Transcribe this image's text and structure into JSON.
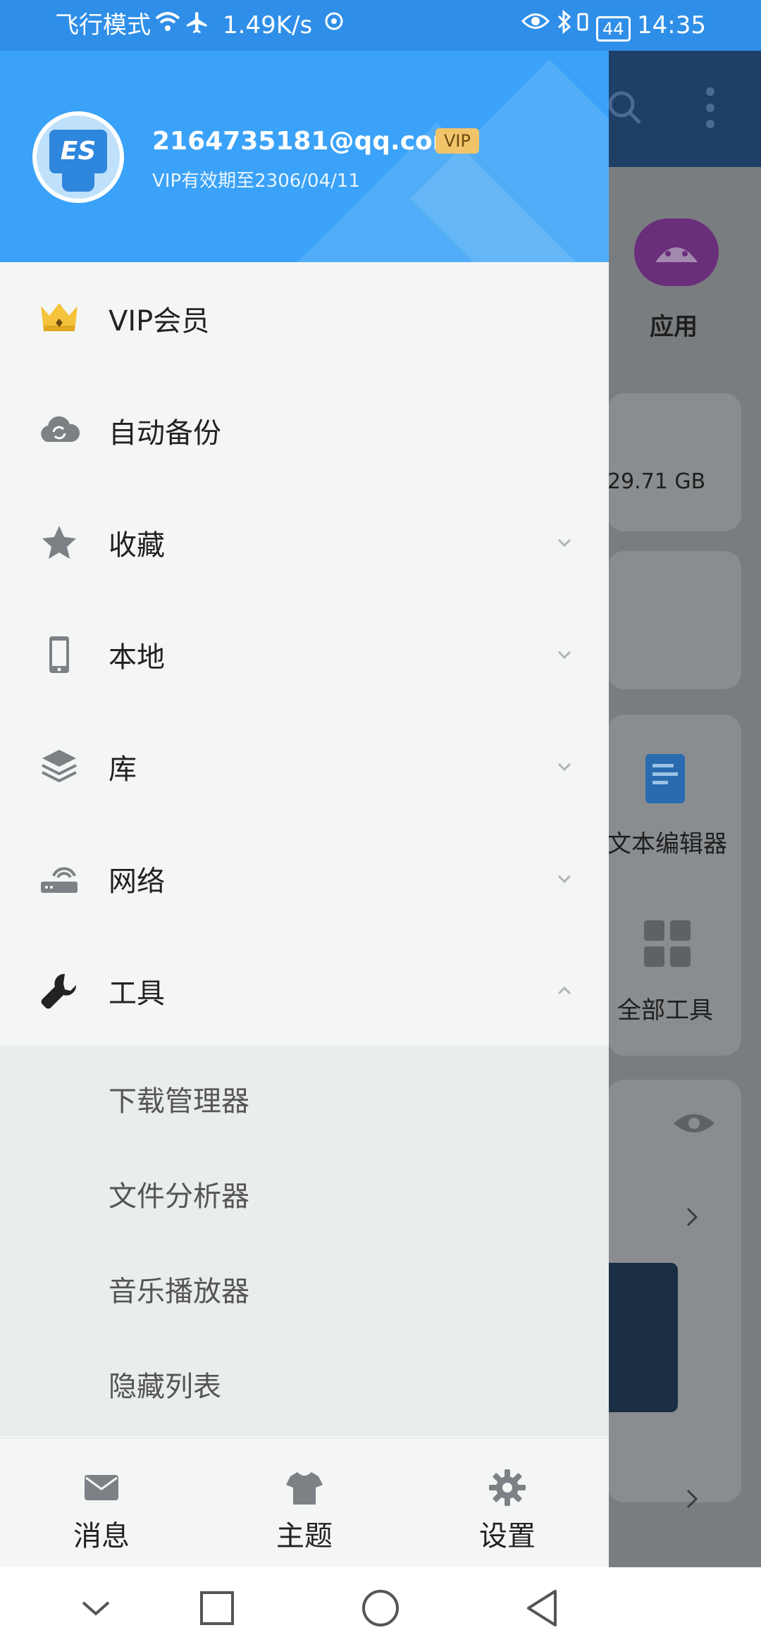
{
  "status_bar": {
    "left_text": "飞行模式",
    "speed": "1.49K/s",
    "battery": "44",
    "time": "14:35"
  },
  "background_app": {
    "app_label": "应用",
    "storage_text": "29.71 GB",
    "tool_text_editor": "文本编辑器",
    "tool_all_tools": "全部工具"
  },
  "drawer": {
    "header": {
      "email": "2164735181@qq.com",
      "vip_badge": "VIP",
      "vip_expire": "VIP有效期至2306/04/11"
    },
    "menu": [
      {
        "label": "VIP会员",
        "icon": "crown-icon"
      },
      {
        "label": "自动备份",
        "icon": "cloud-sync-icon"
      },
      {
        "label": "收藏",
        "icon": "star-icon",
        "chevron": "down"
      },
      {
        "label": "本地",
        "icon": "phone-icon",
        "chevron": "down"
      },
      {
        "label": "库",
        "icon": "layers-icon",
        "chevron": "down"
      },
      {
        "label": "网络",
        "icon": "router-icon",
        "chevron": "down"
      },
      {
        "label": "工具",
        "icon": "wrench-icon",
        "chevron": "up"
      }
    ],
    "tools_submenu": [
      "下载管理器",
      "文件分析器",
      "音乐播放器",
      "隐藏列表"
    ],
    "bottom_tabs": [
      {
        "label": "消息",
        "icon": "mail-icon"
      },
      {
        "label": "主题",
        "icon": "shirt-icon"
      },
      {
        "label": "设置",
        "icon": "gear-icon"
      }
    ]
  },
  "colors": {
    "header_blue": "#3aa2f8",
    "status_blue": "#2f8fe8",
    "drawer_bg": "#f4f6f6",
    "submenu_bg": "#eaeded"
  }
}
